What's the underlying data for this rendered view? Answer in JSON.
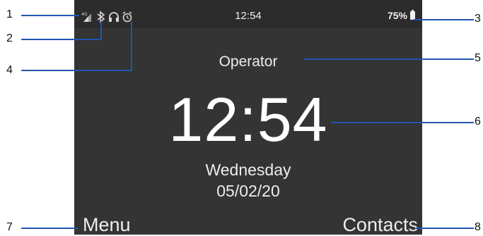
{
  "status_bar": {
    "time": "12:54",
    "battery_percent": "75%",
    "icons": [
      "4g-signal-icon",
      "bluetooth-icon",
      "headphones-icon",
      "alarm-icon"
    ]
  },
  "home": {
    "carrier": "Operator",
    "time": "12:54",
    "day": "Wednesday",
    "date": "05/02/20"
  },
  "softkeys": {
    "left": "Menu",
    "right": "Contacts"
  },
  "callouts": [
    "1",
    "2",
    "3",
    "4",
    "5",
    "6",
    "7",
    "8"
  ],
  "colors": {
    "screen_bg": "#333433",
    "status_bg": "#2b2c2b",
    "callout_line": "#1e56b0",
    "text": "#ffffff"
  }
}
